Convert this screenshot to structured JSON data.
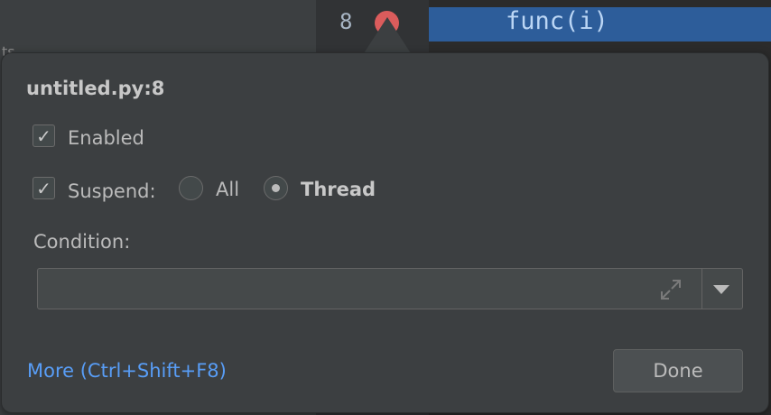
{
  "editor": {
    "line_number": "8",
    "code_line": "func(i)"
  },
  "popup": {
    "title": "untitled.py:8",
    "enabled_label": "Enabled",
    "enabled_checked": true,
    "suspend_label": "Suspend:",
    "suspend_checked": true,
    "suspend_options": [
      {
        "label": "All",
        "selected": false
      },
      {
        "label": "Thread",
        "selected": true
      }
    ],
    "condition_label": "Condition:",
    "condition_value": "",
    "more_link": "More (Ctrl+Shift+F8)",
    "done_label": "Done"
  },
  "colors": {
    "breakpoint": "#db5c5c",
    "link": "#589df6",
    "selection": "#2d5d9a"
  }
}
